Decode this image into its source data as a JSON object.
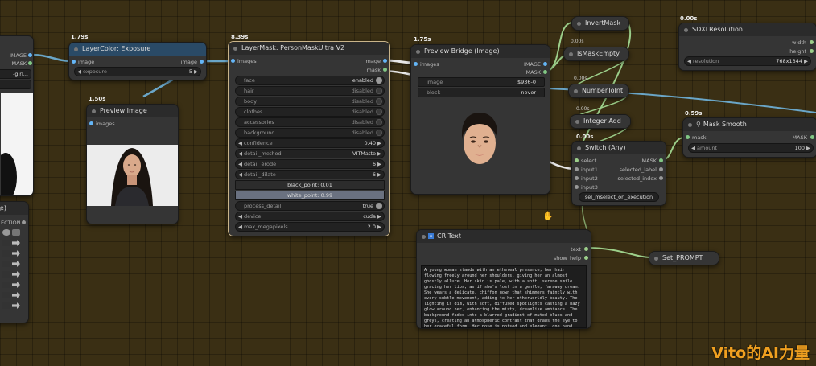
{
  "nodes": {
    "left_partial": {
      "out_image": "IMAGE",
      "out_mask": "MASK",
      "field_text": "-girl...",
      "bottom_title": "ee)",
      "bottom_label": "ECTION"
    },
    "exposure": {
      "time": "1.79s",
      "title": "LayerColor: Exposure",
      "in_image": "image",
      "out_image": "image",
      "widget_label": "exposure",
      "widget_value": "-5"
    },
    "preview_image": {
      "time": "1.50s",
      "title": "Preview Image",
      "in_images": "images"
    },
    "person_mask": {
      "time": "8.39s",
      "title": "LayerMask: PersonMaskUltra V2",
      "in_images": "images",
      "out_image": "image",
      "out_mask": "mask",
      "toggles": [
        {
          "label": "face",
          "value": "enabled"
        },
        {
          "label": "hair",
          "value": "disabled"
        },
        {
          "label": "body",
          "value": "disabled"
        },
        {
          "label": "clothes",
          "value": "disabled"
        },
        {
          "label": "accessories",
          "value": "disabled"
        },
        {
          "label": "background",
          "value": "disabled"
        }
      ],
      "confidence": {
        "label": "confidence",
        "value": "0.40"
      },
      "detail_method": {
        "label": "detail_method",
        "value": "VITMatte"
      },
      "detail_erode": {
        "label": "detail_erode",
        "value": "6"
      },
      "detail_dilate": {
        "label": "detail_dilate",
        "value": "6"
      },
      "black_point": "black_point: 0.01",
      "white_point": "white_point: 0.99",
      "process_detail": {
        "label": "process_detail",
        "value": "true"
      },
      "device": {
        "label": "device",
        "value": "cuda"
      },
      "max_megapixels": {
        "label": "max_megapixels",
        "value": "2.0"
      }
    },
    "preview_bridge": {
      "time": "1.75s",
      "title": "Preview Bridge (Image)",
      "in_images": "images",
      "out_image": "IMAGE",
      "out_mask": "MASK",
      "image_label": "image",
      "image_value": "$936-0",
      "block_label": "block",
      "block_value": "never"
    },
    "invert_mask": {
      "title": "InvertMask"
    },
    "is_mask_empty": {
      "time": "0.00s",
      "title": "IsMaskEmpty"
    },
    "number_to_int": {
      "time": "0.00s",
      "title": "NumberToInt"
    },
    "integer_add": {
      "time": "0.00s",
      "title": "Integer Add"
    },
    "switch_any": {
      "time": "0.00s",
      "title": "Switch (Any)",
      "inputs": [
        "select",
        "input1",
        "input2",
        "input3"
      ],
      "outputs": [
        "MASK",
        "selected_label",
        "selected_index"
      ],
      "button": "sel_mselect_on_execution"
    },
    "sdxl_resolution": {
      "time": "0.00s",
      "title": "SDXLResolution",
      "out_width": "width",
      "out_height": "height",
      "widget_label": "resolution",
      "widget_value": "768x1344"
    },
    "mask_smooth": {
      "time": "0.59s",
      "title": "Mask Smooth",
      "in_mask": "mask",
      "out_mask": "MASK",
      "widget_label": "amount",
      "widget_value": "100"
    },
    "cr_text": {
      "title": "CR Text",
      "out_text": "text",
      "out_show_help": "show_help",
      "text": "A young woman stands with an ethereal presence, her hair flowing freely around her shoulders, giving her an almost ghostly allure. Her skin is pale, with a soft, serene smile gracing her lips, as if she's lost in a gentle, faraway dream. She wears a delicate, chiffon gown that shimmers faintly with every subtle movement, adding to her otherworldly beauty. The lighting is dim, with soft, diffused spotlights casting a hazy glow around her, enhancing the misty, dreamlike ambiance. The background fades into a blurred gradient of muted blues and greys, creating an atmospheric contrast that draws the eye to her graceful form. Her pose is poised and elegant, one hand raised delicately, as if suspended"
    },
    "set_prompt": {
      "title": "Set_PROMPT"
    }
  },
  "watermark": {
    "text": "Vito的AI力量"
  },
  "colors": {
    "background": "#3a2f14",
    "node": "#353535",
    "node_title": "#2b2b2b",
    "exposure_title": "#2a4a66",
    "image_dot": "#64b5f6",
    "mask_dot": "#81c784",
    "wire_blue": "#6aa6c8",
    "wire_green": "#9ccf8a",
    "wire_white": "#e8e8e8",
    "watermark": "#f0a020"
  }
}
